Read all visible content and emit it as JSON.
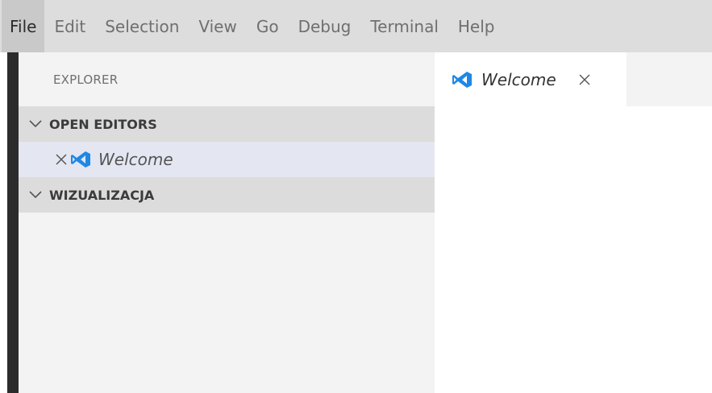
{
  "menu": {
    "file": "File",
    "edit": "Edit",
    "selection": "Selection",
    "view": "View",
    "go": "Go",
    "debug": "Debug",
    "terminal": "Terminal",
    "help": "Help"
  },
  "sidebar": {
    "title": "EXPLORER",
    "sections": [
      {
        "label": "OPEN EDITORS",
        "expanded": true
      },
      {
        "label": "WIZUALIZACJA",
        "expanded": true
      }
    ],
    "open_editors": [
      {
        "label": "Welcome",
        "icon": "vscode-icon"
      }
    ]
  },
  "tabs": [
    {
      "label": "Welcome",
      "icon": "vscode-icon",
      "active": true
    }
  ],
  "colors": {
    "menubar_bg": "#dddddd",
    "sidebar_bg": "#f3f3f3",
    "section_header_bg": "#dcdcdc",
    "selected_row_bg": "#e4e6f1",
    "activity_bar": "#2c2c2c",
    "vscode_blue": "#1e88e5"
  }
}
